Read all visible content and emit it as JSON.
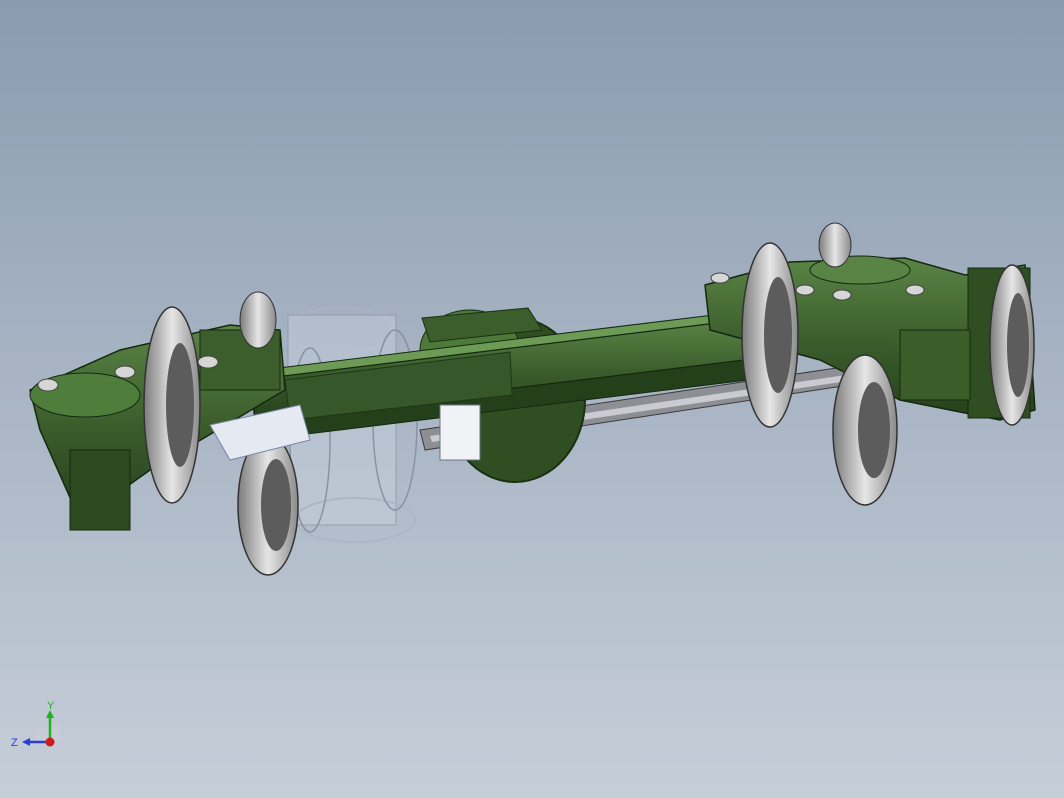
{
  "viewport": {
    "background_top": "#8a9bb0",
    "background_bottom": "#c6ced8"
  },
  "model": {
    "part_color": "#3c5e2c",
    "part_color_dark": "#24401b",
    "part_color_light": "#5a8446",
    "wheel_color": "#cfcfcf",
    "transparent_part_color": "#e3e8f2"
  },
  "triad": {
    "y_label": "Y",
    "z_label": "Z",
    "x_color": "#d11a1a",
    "y_color": "#1fb21f",
    "z_color": "#2a3fd6"
  }
}
